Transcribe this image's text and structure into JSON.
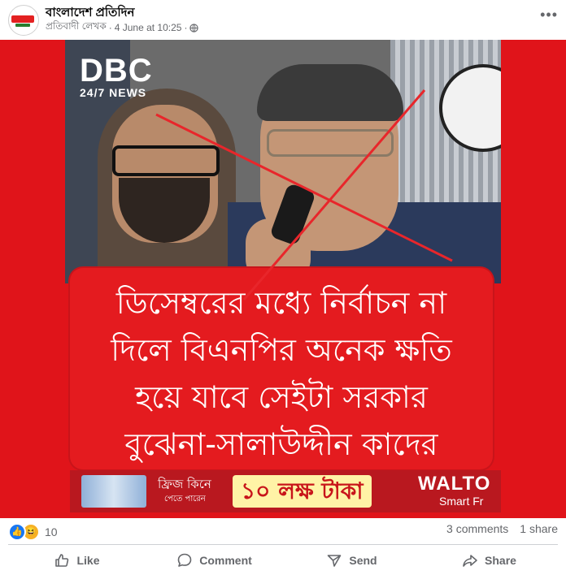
{
  "post": {
    "page_name": "বাংলাদেশ প্রতিদিন",
    "author": "প্রতিবাদী লেখক",
    "timestamp": "4 June at 10:25",
    "separator": "·",
    "more_icon": "more-dots-icon"
  },
  "image": {
    "logo_main": "DBC",
    "logo_sub": "24/7 NEWS",
    "headline_lines": [
      "ডিসেম্বরের মধ্যে নির্বাচন না",
      "দিলে বিএনপির অনেক ক্ষতি",
      "হয়ে যাবে সেইটা সরকার",
      "বুঝেনা-সালাউদ্দীন কাদের"
    ],
    "ad": {
      "line1": "ফ্রিজ কিনে",
      "line2": "পেতে পারেন",
      "amount": "১০ লক্ষ টাকা",
      "brand": "WALTO",
      "brand_sub": "Smart Fr"
    },
    "colors": {
      "background": "#e0141a",
      "cross": "#e8262b"
    }
  },
  "footer": {
    "reaction_count": "10",
    "comments": "3 comments",
    "shares": "1 share",
    "actions": {
      "like": "Like",
      "comment": "Comment",
      "send": "Send",
      "share": "Share"
    }
  }
}
